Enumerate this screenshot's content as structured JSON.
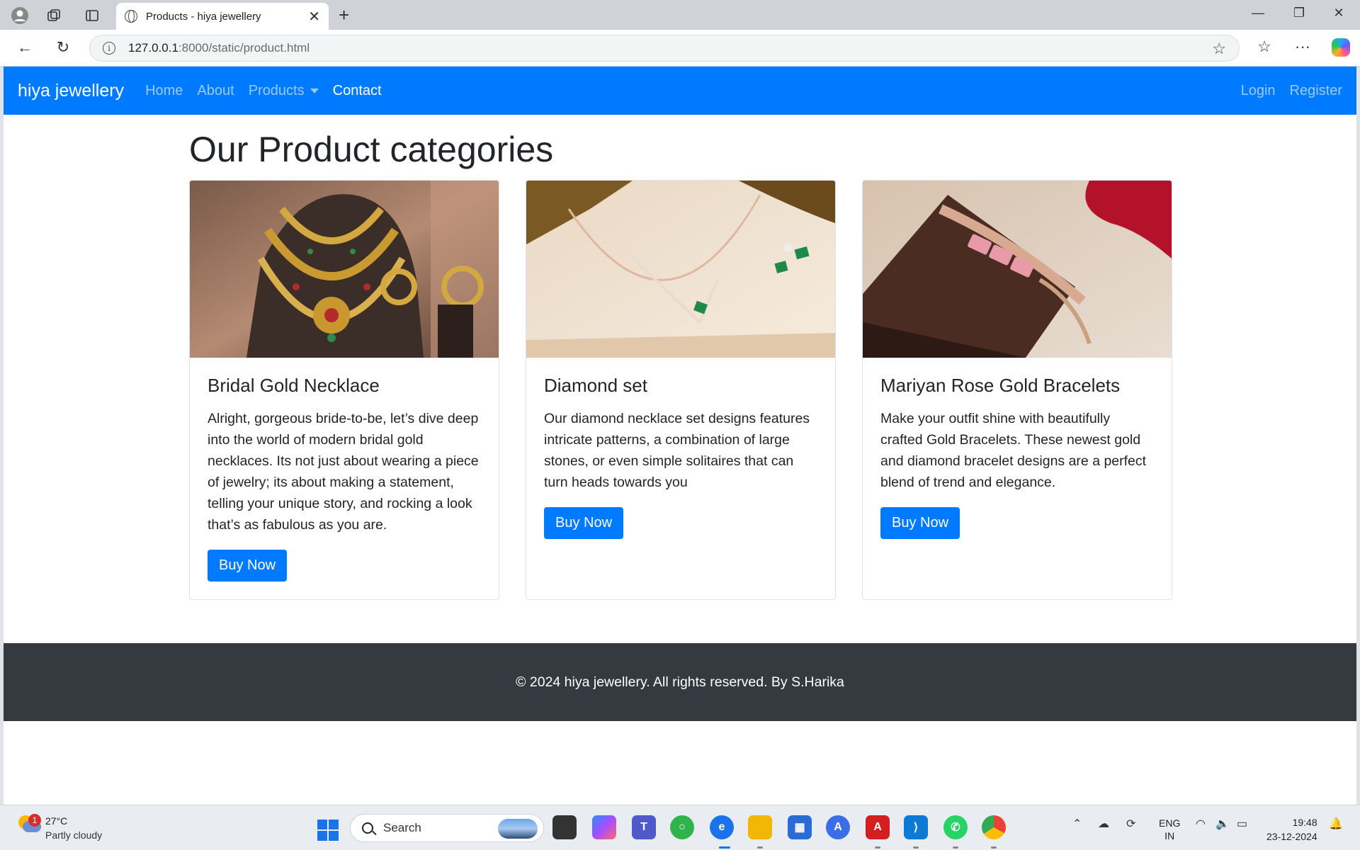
{
  "browser": {
    "tab_title": "Products - hiya jewellery",
    "url_host": "127.0.0.1",
    "url_path": ":8000/static/product.html"
  },
  "site": {
    "brand": "hiya jewellery",
    "nav": {
      "home": "Home",
      "about": "About",
      "products": "Products",
      "contact": "Contact",
      "login": "Login",
      "register": "Register"
    },
    "page_title": "Our Product categories",
    "cards": [
      {
        "title": "Bridal Gold Necklace",
        "text": "Alright, gorgeous bride-to-be, let’s dive deep into the world of modern bridal gold necklaces. Its not just about wearing a piece of jewelry; its about making a statement, telling your unique story, and rocking a look that’s as fabulous as you are.",
        "button": "Buy Now"
      },
      {
        "title": "Diamond set",
        "text": "Our diamond necklace set designs features intricate patterns, a combination of large stones, or even simple solitaires that can turn heads towards you",
        "button": "Buy Now"
      },
      {
        "title": "Mariyan Rose Gold Bracelets",
        "text": "Make your outfit shine with beautifully crafted Gold Bracelets. These newest gold and diamond bracelet designs are a perfect blend of trend and elegance.",
        "button": "Buy Now"
      }
    ],
    "footer": "© 2024 hiya jewellery. All rights reserved. By S.Harika"
  },
  "taskbar": {
    "weather_temp": "27°C",
    "weather_cond": "Partly cloudy",
    "weather_badge": "1",
    "search_placeholder": "Search",
    "lang_line1": "ENG",
    "lang_line2": "IN",
    "time": "19:48",
    "date": "23-12-2024"
  },
  "colors": {
    "navbar": "#007bff",
    "footer": "#343a40",
    "button": "#007bff"
  }
}
